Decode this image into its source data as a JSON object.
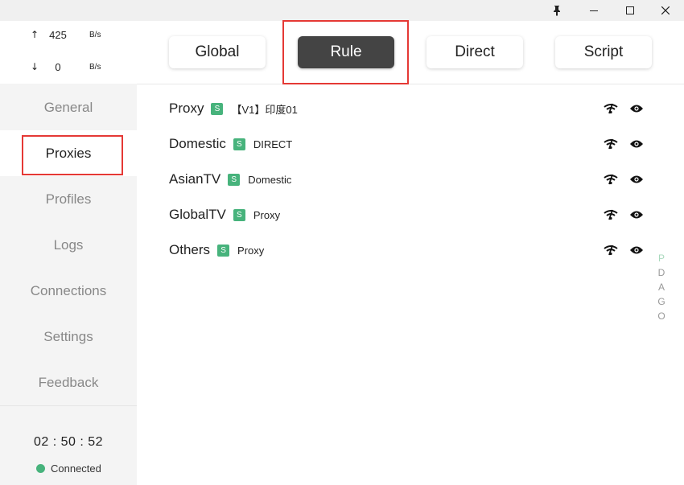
{
  "titlebar": {
    "pin_icon": "pin-icon",
    "minimize_icon": "minimize-icon",
    "maximize_icon": "maximize-icon",
    "close_icon": "close-icon"
  },
  "traffic": {
    "up_arrow": "↑",
    "up_value": "425",
    "up_unit": "B/s",
    "down_arrow": "↓",
    "down_value": "0",
    "down_unit": "B/s"
  },
  "nav": {
    "general": "General",
    "proxies": "Proxies",
    "profiles": "Profiles",
    "logs": "Logs",
    "connections": "Connections",
    "settings": "Settings",
    "feedback": "Feedback",
    "active": "Proxies"
  },
  "footer": {
    "clock": "02 : 50 : 52",
    "status": "Connected",
    "status_color": "#47b37c"
  },
  "modes": {
    "global": "Global",
    "rule": "Rule",
    "direct": "Direct",
    "script": "Script",
    "active": "Rule"
  },
  "groups": [
    {
      "name": "Proxy",
      "badge": "S",
      "now": "【V1】印度01"
    },
    {
      "name": "Domestic",
      "badge": "S",
      "now": "DIRECT"
    },
    {
      "name": "AsianTV",
      "badge": "S",
      "now": "Domestic"
    },
    {
      "name": "GlobalTV",
      "badge": "S",
      "now": "Proxy"
    },
    {
      "name": "Others",
      "badge": "S",
      "now": "Proxy"
    }
  ],
  "side_letters": [
    "P",
    "D",
    "A",
    "G",
    "O"
  ],
  "colors": {
    "accent": "#47b37c",
    "active_mode_bg": "#444444",
    "highlight": "#e53935"
  }
}
